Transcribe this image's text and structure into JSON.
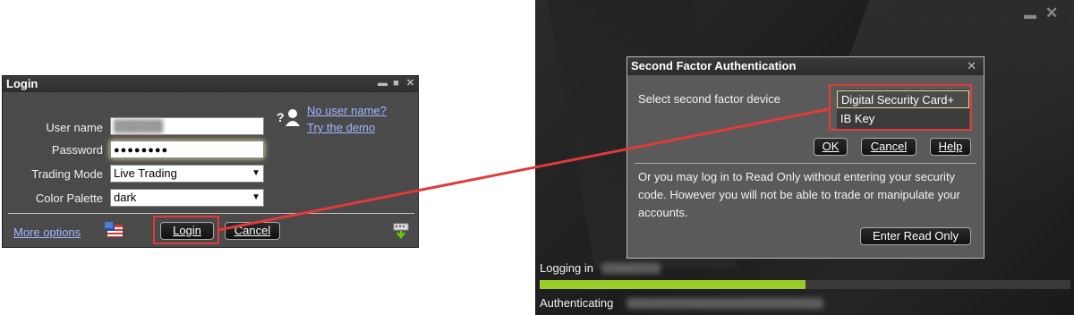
{
  "login": {
    "title": "Login",
    "username_label": "User name",
    "password_label": "Password",
    "password_value": "●●●●●●●●",
    "trading_mode_label": "Trading Mode",
    "trading_mode_value": "Live Trading",
    "color_palette_label": "Color Palette",
    "color_palette_value": "dark",
    "no_user_name_link": "No user name?",
    "try_demo_link": "Try the demo",
    "help_glyph": "?",
    "more_options_link": "More options",
    "login_button": "Login",
    "cancel_button": "Cancel"
  },
  "second_factor": {
    "title": "Second Factor Authentication",
    "select_label": "Select second factor device",
    "options": [
      "Digital Security Card+",
      "IB Key"
    ],
    "selected_option": "Digital Security Card+",
    "ok_button": "OK",
    "cancel_button": "Cancel",
    "help_button": "Help",
    "read_only_message": "Or you may log in to Read Only without entering your security code. However you will not be able to trade or manipulate your accounts.",
    "enter_read_only_button": "Enter Read Only"
  },
  "status": {
    "logging_in_label": "Logging in",
    "authenticating_label": "Authenticating",
    "progress_fraction": 0.5
  },
  "colors": {
    "annotation_red": "#e03a3a",
    "progress_green": "#9acd2a",
    "link_blue": "#9fb6ff",
    "selected_option_border": "#e9d98a"
  },
  "icons": {
    "minimize": "minimize-icon",
    "maximize": "maximize-icon",
    "close": "close-icon",
    "user_help": "user-help-icon",
    "flag": "us-flag-icon",
    "keyboard": "keyboard-download-icon"
  }
}
